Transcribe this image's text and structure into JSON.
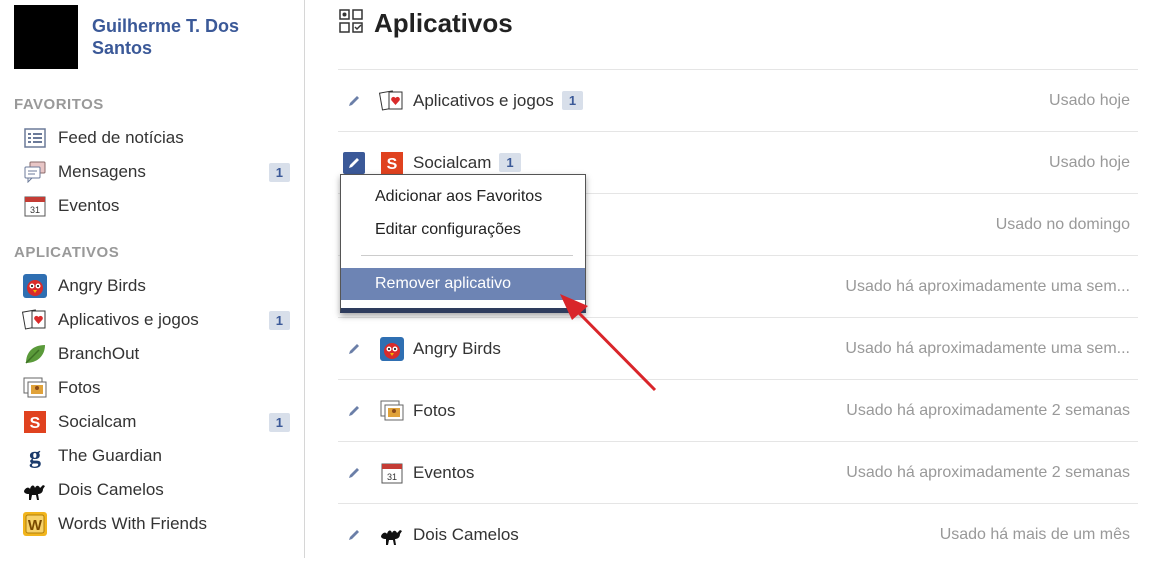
{
  "profile": {
    "name": "Guilherme T. Dos Santos"
  },
  "sidebar": {
    "favorites_title": "FAVORITOS",
    "favorites": [
      {
        "label": "Feed de notícias",
        "icon": "news-feed-icon"
      },
      {
        "label": "Mensagens",
        "icon": "messages-icon",
        "badge": "1"
      },
      {
        "label": "Eventos",
        "icon": "calendar-icon"
      }
    ],
    "apps_title": "APLICATIVOS",
    "apps": [
      {
        "label": "Angry Birds",
        "icon": "angry-birds-icon"
      },
      {
        "label": "Aplicativos e jogos",
        "icon": "apps-games-icon",
        "badge": "1"
      },
      {
        "label": "BranchOut",
        "icon": "branchout-leaf-icon"
      },
      {
        "label": "Fotos",
        "icon": "photos-icon"
      },
      {
        "label": "Socialcam",
        "icon": "socialcam-icon",
        "badge": "1"
      },
      {
        "label": "The Guardian",
        "icon": "guardian-icon"
      },
      {
        "label": "Dois Camelos",
        "icon": "camel-icon"
      },
      {
        "label": "Words With Friends",
        "icon": "words-with-friends-icon"
      }
    ]
  },
  "main": {
    "title": "Aplicativos",
    "rows": [
      {
        "name": "Aplicativos e jogos",
        "badge": "1",
        "usage": "Usado hoje",
        "icon": "apps-games-icon"
      },
      {
        "name": "Socialcam",
        "badge": "1",
        "usage": "Usado hoje",
        "icon": "socialcam-icon"
      },
      {
        "name": "",
        "usage": "Usado no domingo"
      },
      {
        "name": "",
        "usage": "Usado há aproximadamente uma sem..."
      },
      {
        "name": "Angry Birds",
        "usage": "Usado há aproximadamente uma sem...",
        "icon": "angry-birds-icon"
      },
      {
        "name": "Fotos",
        "usage": "Usado há aproximadamente 2 semanas",
        "icon": "photos-icon"
      },
      {
        "name": "Eventos",
        "usage": "Usado há aproximadamente 2 semanas",
        "icon": "calendar-icon"
      },
      {
        "name": "Dois Camelos",
        "usage": "Usado há mais de um mês",
        "icon": "camel-icon"
      }
    ]
  },
  "menu": {
    "add_favorites": "Adicionar aos Favoritos",
    "edit_settings": "Editar configurações",
    "remove_app": "Remover aplicativo"
  },
  "colors": {
    "brand": "#3b5998",
    "highlight": "#6d84b4",
    "badge_bg": "#d8dfea",
    "arrow": "#d9252a"
  }
}
